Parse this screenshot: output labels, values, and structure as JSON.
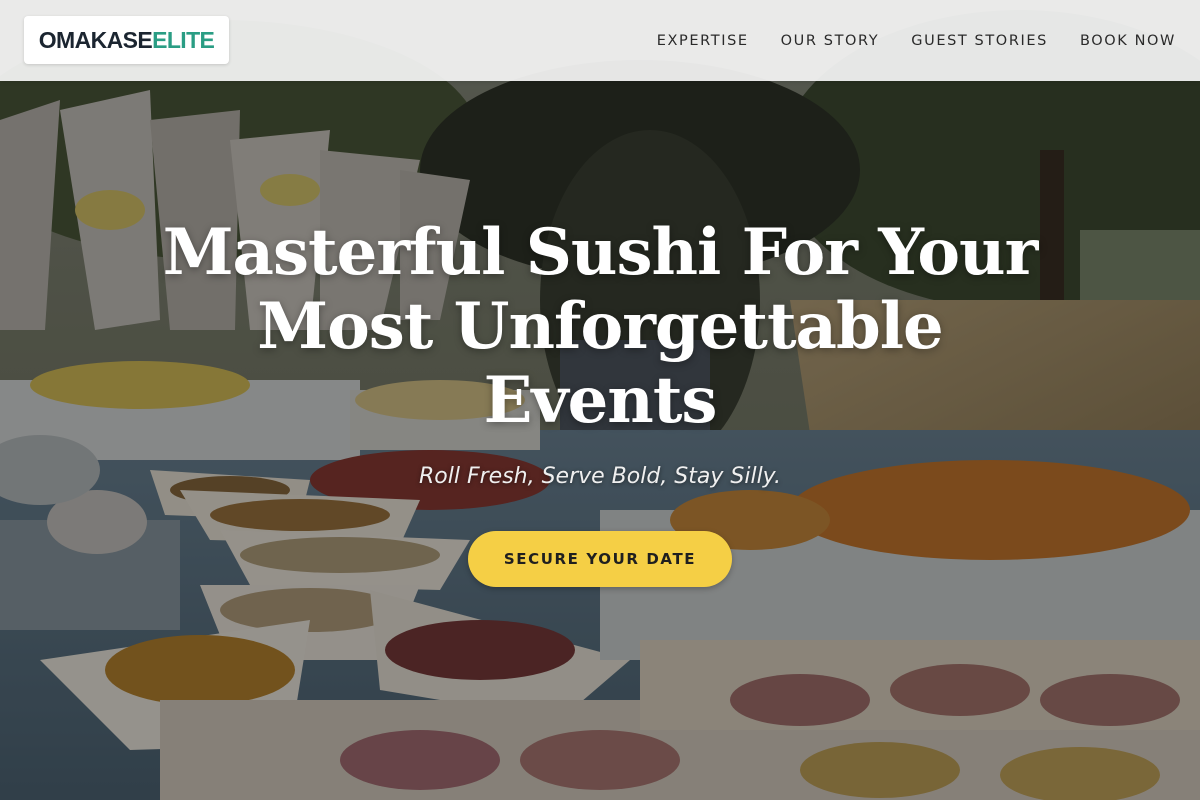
{
  "header": {
    "logo": {
      "part1": "OMAKASE",
      "part2": "ELITE"
    },
    "nav": [
      {
        "label": "EXPERTISE"
      },
      {
        "label": "OUR STORY"
      },
      {
        "label": "GUEST STORIES"
      },
      {
        "label": "BOOK NOW"
      }
    ]
  },
  "hero": {
    "title": "Masterful Sushi For Your Most Unforgettable Events",
    "subtitle": "Roll Fresh, Serve Bold, Stay Silly.",
    "cta_label": "SECURE YOUR DATE",
    "background_image": "outdoor catering buffet table with snacks and sandwiches"
  },
  "colors": {
    "logo_dark": "#1b2530",
    "logo_accent": "#2a9d84",
    "cta_background": "#f5cf45",
    "header_background": "#f5f5f5"
  }
}
